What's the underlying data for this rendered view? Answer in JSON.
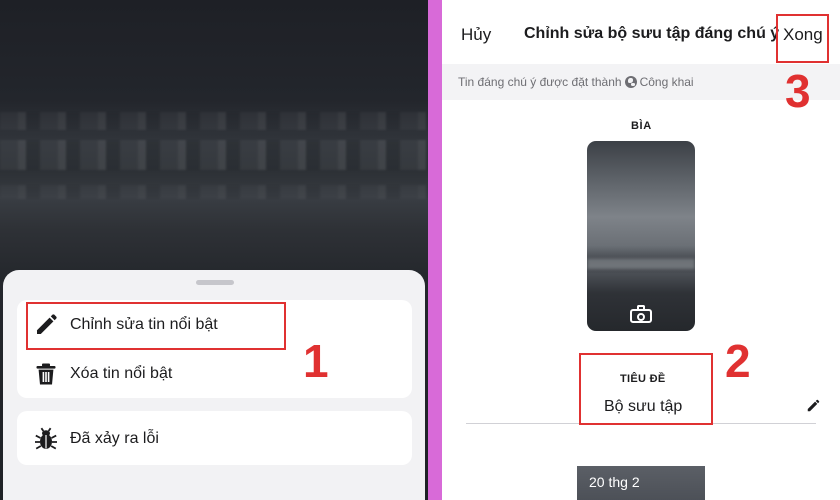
{
  "left": {
    "menu": {
      "edit_label": "Chỉnh sửa tin nổi bật",
      "delete_label": "Xóa tin nổi bật",
      "report_label": "Đã xảy ra lỗi"
    }
  },
  "right": {
    "nav": {
      "cancel_label": "Hủy",
      "title": "Chỉnh sửa bộ sưu tập đáng chú ý",
      "done_label": "Xong"
    },
    "privacy": {
      "text": "Tin đáng chú ý được đặt thành",
      "audience": "Công khai"
    },
    "cover_label": "BÌA",
    "title_label": "TIÊU ĐỀ",
    "title_value": "Bộ sưu tập",
    "story_date": "20 thg 2"
  },
  "annotations": {
    "step1": "1",
    "step2": "2",
    "step3": "3"
  },
  "colors": {
    "annotation": "#e03131",
    "divider": "#d86ad8"
  },
  "icons": {
    "edit": "pencil-icon",
    "delete": "trash-icon",
    "report": "bug-icon",
    "privacy": "globe-icon",
    "cover": "camera-icon",
    "title_edit": "pencil-icon"
  }
}
